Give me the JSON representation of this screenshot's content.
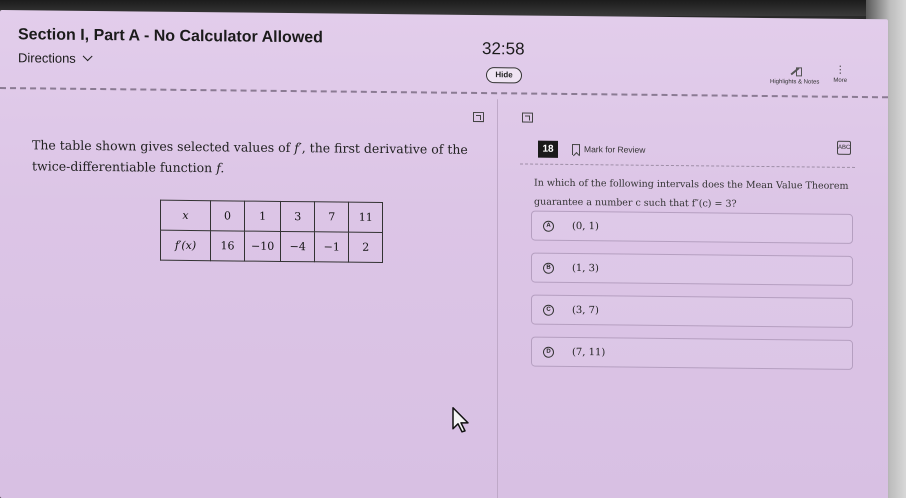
{
  "header": {
    "section_title": "Section I, Part A - No Calculator Allowed",
    "directions_label": "Directions",
    "timer": "32:58",
    "hide_label": "Hide",
    "highlights_label": "Highlights & Notes",
    "more_label": "More"
  },
  "passage": {
    "stem_line1": "The table shown gives selected values of",
    "stem_symbol": "f′",
    "stem_line1_end": ", the first derivative of the",
    "stem_line2": "twice-differentiable function",
    "stem_fn": "f.",
    "table": {
      "header_label": "x",
      "row_label": "f′(x)",
      "x_values": [
        "0",
        "1",
        "3",
        "7",
        "11"
      ],
      "fprime_values": [
        "16",
        "−10",
        "−4",
        "−1",
        "2"
      ]
    }
  },
  "question": {
    "number": "18",
    "mark_label": "Mark for Review",
    "abc_label": "ABC",
    "text_line1": "In which of the following intervals does the Mean Value Theorem",
    "text_line2": "guarantee a number c such that f″(c) = 3?",
    "choices": [
      {
        "letter": "A",
        "text": "(0, 1)"
      },
      {
        "letter": "B",
        "text": "(1, 3)"
      },
      {
        "letter": "C",
        "text": "(3, 7)"
      },
      {
        "letter": "D",
        "text": "(7, 11)"
      }
    ]
  }
}
